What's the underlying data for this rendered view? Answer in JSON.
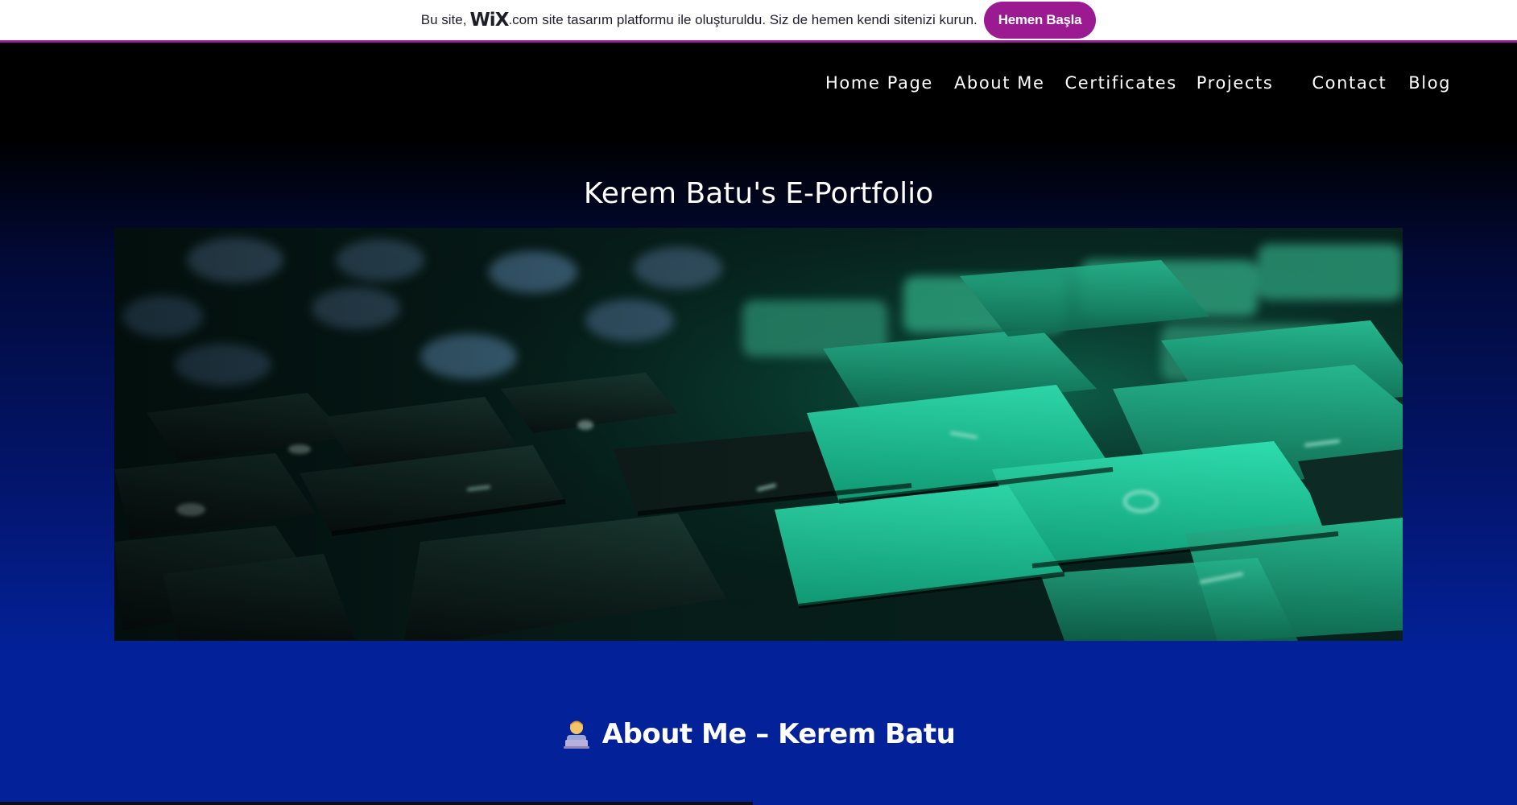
{
  "banner": {
    "text_before": "Bu site,",
    "brand": "WiX",
    "brand_suffix": ".com",
    "text_after": "site tasarım platformu ile oluşturuldu. Siz de hemen kendi sitenizi kurun.",
    "cta_label": "Hemen Başla"
  },
  "nav": {
    "items": [
      {
        "label": "Home Page"
      },
      {
        "label": "About Me"
      },
      {
        "label": "Certificates"
      },
      {
        "label": "Projects"
      },
      {
        "label": "Contact"
      },
      {
        "label": "Blog"
      }
    ]
  },
  "hero": {
    "title": "Kerem Batu's E-Portfolio"
  },
  "about": {
    "icon": "technologist-emoji-icon",
    "title": "About Me – Kerem Batu"
  },
  "colors": {
    "banner_accent": "#9b1a92",
    "nav_background": "#000000",
    "page_gradient_bottom": "#03229a",
    "key_green": "#19c79a"
  }
}
